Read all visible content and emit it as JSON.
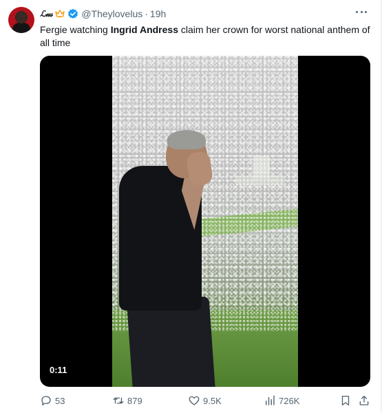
{
  "tweet": {
    "display_name": "ℒ𝓊𝓈",
    "handle": "@Theylovelus",
    "separator": "·",
    "time": "19h",
    "text_parts": {
      "before": "Fergie watching ",
      "bold": "Ingrid Andress",
      "after": " claim her crown for worst national anthem of all time"
    }
  },
  "media": {
    "duration": "0:11"
  },
  "actions": {
    "replies": "53",
    "reposts": "879",
    "likes": "9.5K",
    "views": "726K"
  },
  "colors": {
    "text": "#0f1419",
    "secondary": "#536471",
    "verified": "#1d9bf0",
    "crown": "#f5a623"
  },
  "icons": [
    "crown-icon",
    "verified-icon",
    "more-icon",
    "reply-icon",
    "repost-icon",
    "like-icon",
    "views-icon",
    "bookmark-icon",
    "share-icon"
  ]
}
